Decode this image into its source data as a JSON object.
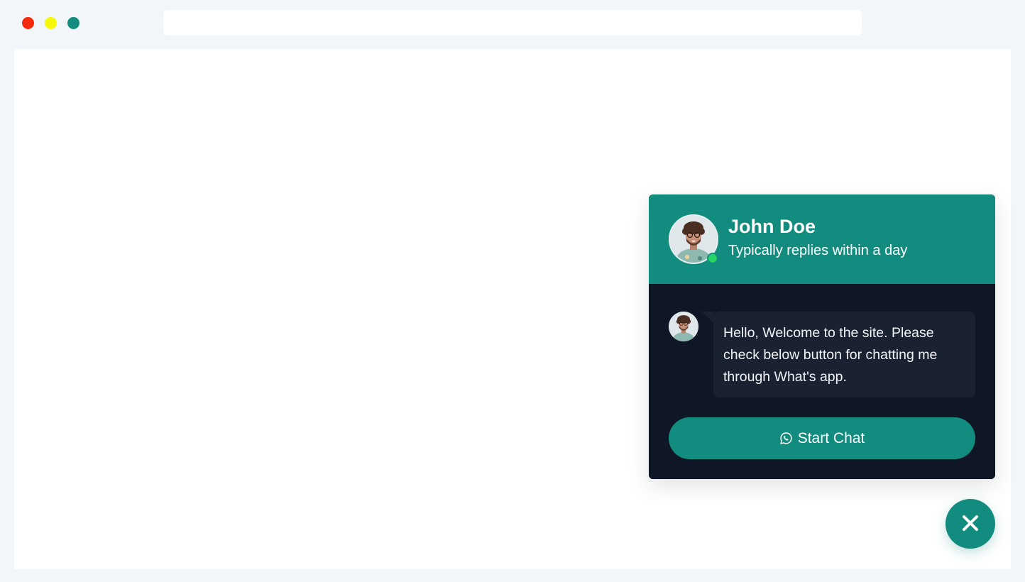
{
  "colors": {
    "dot_red": "#f5290c",
    "dot_yellow": "#f7f70c",
    "dot_green": "#128c7e",
    "brand": "#128c7e",
    "body_bg": "#0f1726",
    "bubble_bg": "#1a2232",
    "online": "#25d366"
  },
  "widget": {
    "agent_name": "John Doe",
    "agent_status": "Typically replies within a day",
    "message": "Hello, Welcome to the site. Please check below button for chatting me through What's app.",
    "start_chat_label": "Start Chat",
    "start_chat_icon": "whatsapp-icon",
    "close_icon": "close-icon"
  }
}
